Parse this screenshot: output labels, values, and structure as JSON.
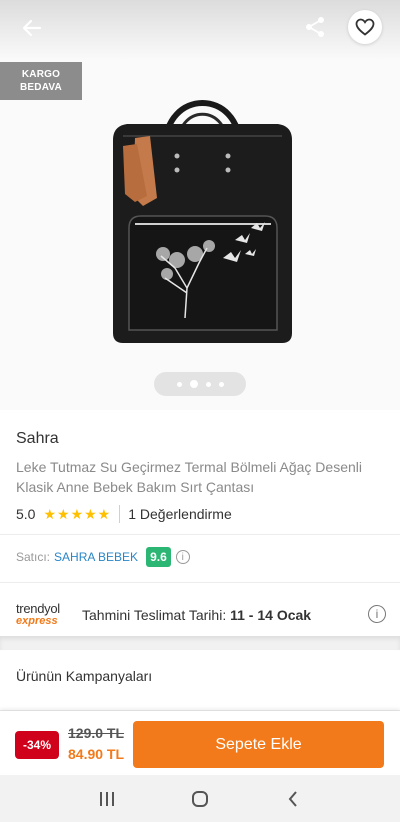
{
  "header": {
    "back_icon": "arrow-left-icon",
    "share_icon": "share-icon",
    "favorite_icon": "heart-outline-icon"
  },
  "badge": {
    "line1": "KARGO",
    "line2": "BEDAVA"
  },
  "gallery": {
    "page_count": 4,
    "active_index": 1
  },
  "product": {
    "brand": "Sahra",
    "title": "Leke Tutmaz Su Geçirmez Termal Bölmeli Ağaç Desenli Klasik Anne Bebek Bakım Sırt Çantası",
    "rating": "5.0",
    "stars": "★★★★★",
    "reviews": "1 Değerlendirme"
  },
  "seller": {
    "label": "Satıcı:",
    "name": "SAHRA BEBEK",
    "score": "9.6"
  },
  "delivery": {
    "logo_main": "trendyol",
    "logo_sub": "express",
    "label": "Tahmini Teslimat Tarihi:",
    "dates": "11 - 14 Ocak"
  },
  "campaigns": {
    "title": "Ürünün Kampanyaları"
  },
  "buy": {
    "discount": "-34%",
    "old_price": "129.0 TL",
    "new_price": "84.90 TL",
    "button": "Sepete Ekle"
  },
  "colors": {
    "accent": "#f27a1a",
    "discount": "#d0021b",
    "seller_score": "#2bb673",
    "link": "#2a86c7"
  }
}
